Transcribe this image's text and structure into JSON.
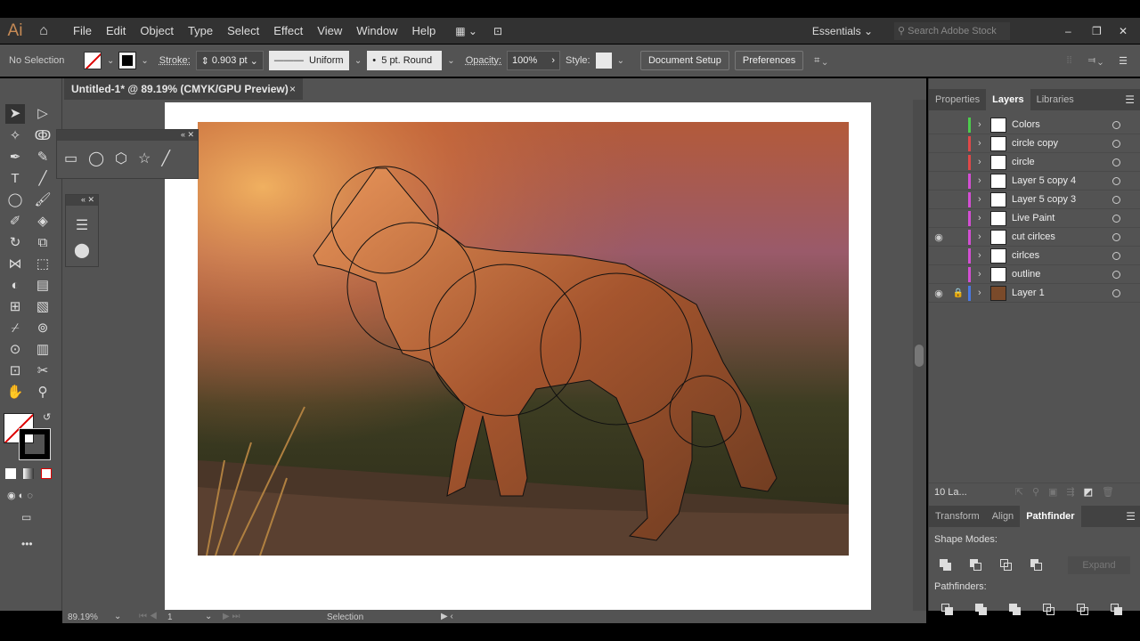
{
  "app": {
    "logo": "Ai",
    "menus": [
      "File",
      "Edit",
      "Object",
      "Type",
      "Select",
      "Effect",
      "View",
      "Window",
      "Help"
    ],
    "workspace": "Essentials",
    "search_placeholder": "Search Adobe Stock"
  },
  "control": {
    "selection": "No Selection",
    "stroke_label": "Stroke:",
    "stroke_value": "0.903 pt",
    "profile": "Uniform",
    "brush": "5 pt. Round",
    "opacity_label": "Opacity:",
    "opacity_value": "100%",
    "style_label": "Style:",
    "document_setup": "Document Setup",
    "preferences": "Preferences"
  },
  "document": {
    "tab_title": "Untitled-1* @ 89.19% (CMYK/GPU Preview)",
    "close": "×"
  },
  "panel": {
    "tabs": [
      "Properties",
      "Layers",
      "Libraries"
    ],
    "active_tab": "Layers",
    "layers": [
      {
        "name": "Colors",
        "color": "#4ccc4c"
      },
      {
        "name": "circle copy",
        "color": "#e04848"
      },
      {
        "name": "circle",
        "color": "#e04848"
      },
      {
        "name": "Layer 5 copy 4",
        "color": "#d44ed4"
      },
      {
        "name": "Layer 5 copy 3",
        "color": "#d44ed4"
      },
      {
        "name": "Live Paint",
        "color": "#d44ed4"
      },
      {
        "name": "cut cirlces",
        "color": "#d44ed4"
      },
      {
        "name": "cirlces",
        "color": "#d44ed4"
      },
      {
        "name": "outline",
        "color": "#d44ed4"
      },
      {
        "name": "Layer 1",
        "color": "#4a78e0"
      }
    ],
    "layer_count": "10 La..."
  },
  "bottom_panel": {
    "tabs": [
      "Transform",
      "Align",
      "Pathfinder"
    ],
    "active_tab": "Pathfinder",
    "shape_modes": "Shape Modes:",
    "expand": "Expand",
    "pathfinders": "Pathfinders:"
  },
  "status": {
    "zoom": "89.19%",
    "page": "1",
    "tool": "Selection"
  }
}
